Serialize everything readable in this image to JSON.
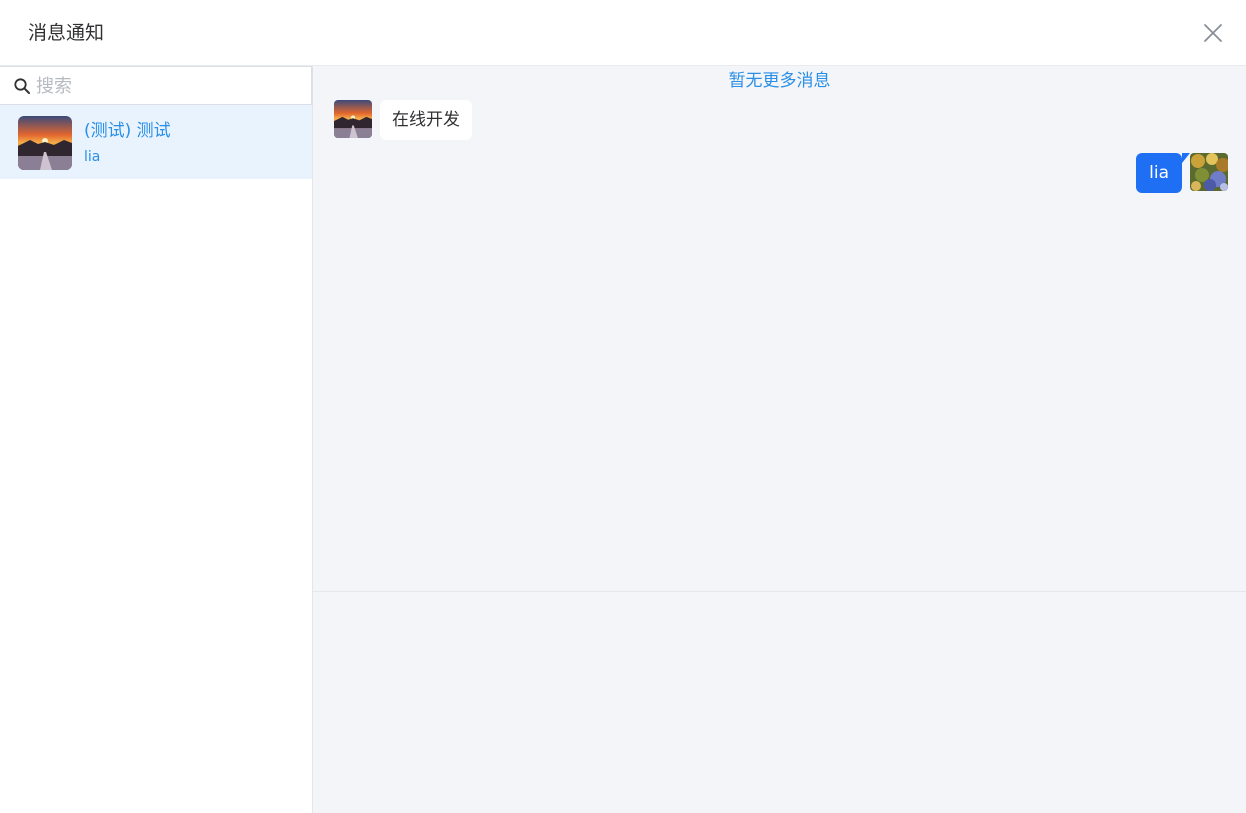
{
  "header": {
    "title": "消息通知",
    "close_icon": "close-icon"
  },
  "sidebar": {
    "search": {
      "placeholder": "搜索",
      "value": "",
      "icon": "search-icon"
    },
    "contacts": [
      {
        "name": "(测试) 测试",
        "last_message": "lia",
        "avatar": "sunset-road-avatar",
        "selected": true
      }
    ]
  },
  "chat": {
    "history_notice": "暂无更多消息",
    "messages": [
      {
        "side": "left",
        "text": "在线开发",
        "avatar": "sunset-road-avatar"
      },
      {
        "side": "right",
        "text": "lia",
        "avatar": "autumn-leaves-avatar"
      }
    ]
  },
  "composer": {
    "value": ""
  },
  "colors": {
    "accent": "#2a8fe6",
    "sent_bubble": "#1f6ff5",
    "selected_item_bg": "#e8f3fe",
    "chat_bg": "#f3f5f8"
  }
}
